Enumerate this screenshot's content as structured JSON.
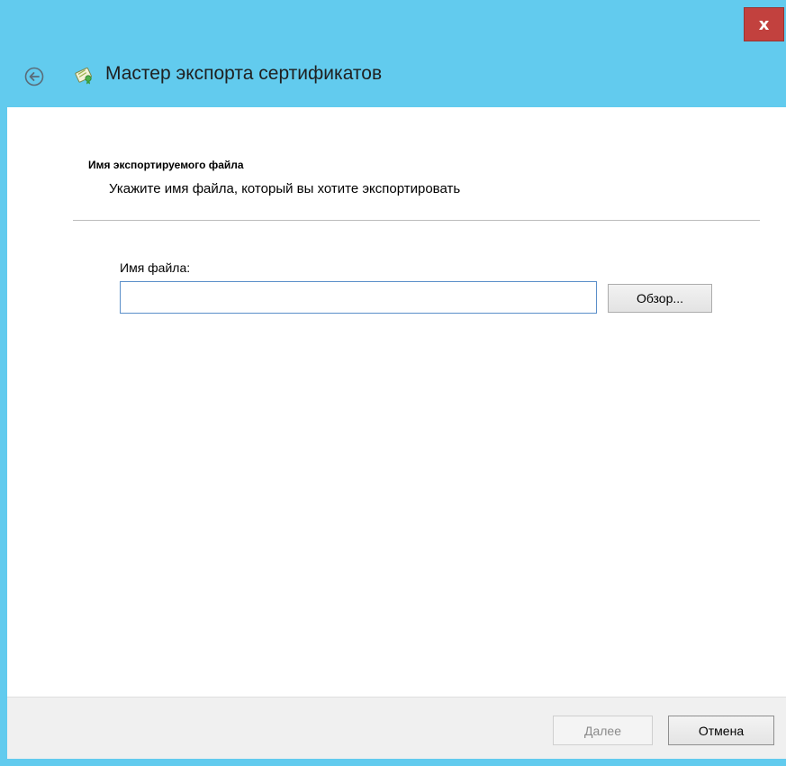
{
  "window": {
    "title": "Мастер экспорта сертификатов",
    "close_label": "x",
    "accent_color": "#62cbee",
    "close_color": "#c2413e"
  },
  "header": {
    "back_icon": "back-arrow-icon",
    "app_icon": "certificate-icon"
  },
  "page": {
    "section_title": "Имя экспортируемого файла",
    "section_subtitle": "Укажите имя файла, который вы хотите экспортировать",
    "file_label": "Имя файла:",
    "file_value": "",
    "browse_label": "Обзор..."
  },
  "footer": {
    "next_label": "Далее",
    "cancel_label": "Отмена"
  }
}
